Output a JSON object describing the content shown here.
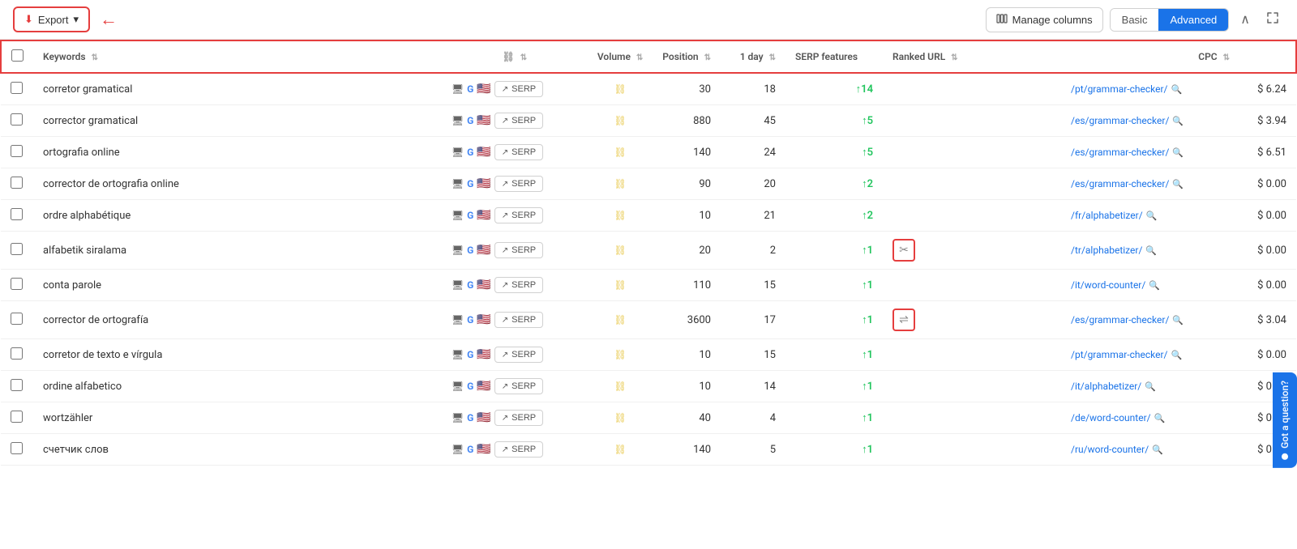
{
  "toolbar": {
    "export_label": "Export",
    "manage_columns_label": "Manage columns",
    "view_basic_label": "Basic",
    "view_advanced_label": "Advanced",
    "active_view": "Advanced"
  },
  "table": {
    "headers": {
      "keyword": "Keywords",
      "link": "",
      "volume": "Volume",
      "position": "Position",
      "oneday": "1 day",
      "serp_features": "SERP features",
      "ranked_url": "Ranked URL",
      "cpc": "CPC"
    },
    "rows": [
      {
        "keyword": "corretor gramatical",
        "volume": "30",
        "position": "18",
        "oneday": "↑14",
        "oneday_val": 14,
        "serp_feature": "",
        "ranked_url": "/pt/grammar-checker/",
        "cpc": "$ 6.24"
      },
      {
        "keyword": "corrector gramatical",
        "volume": "880",
        "position": "45",
        "oneday": "↑5",
        "oneday_val": 5,
        "serp_feature": "",
        "ranked_url": "/es/grammar-checker/",
        "cpc": "$ 3.94"
      },
      {
        "keyword": "ortografia online",
        "volume": "140",
        "position": "24",
        "oneday": "↑5",
        "oneday_val": 5,
        "serp_feature": "",
        "ranked_url": "/es/grammar-checker/",
        "cpc": "$ 6.51"
      },
      {
        "keyword": "corrector de ortografia online",
        "volume": "90",
        "position": "20",
        "oneday": "↑2",
        "oneday_val": 2,
        "serp_feature": "",
        "ranked_url": "/es/grammar-checker/",
        "cpc": "$ 0.00"
      },
      {
        "keyword": "ordre alphabétique",
        "volume": "10",
        "position": "21",
        "oneday": "↑2",
        "oneday_val": 2,
        "serp_feature": "",
        "ranked_url": "/fr/alphabetizer/",
        "cpc": "$ 0.00"
      },
      {
        "keyword": "alfabetik siralama",
        "volume": "20",
        "position": "2",
        "oneday": "↑1",
        "oneday_val": 1,
        "serp_feature": "scissors",
        "ranked_url": "/tr/alphabetizer/",
        "cpc": "$ 0.00"
      },
      {
        "keyword": "conta parole",
        "volume": "110",
        "position": "15",
        "oneday": "↑1",
        "oneday_val": 1,
        "serp_feature": "",
        "ranked_url": "/it/word-counter/",
        "cpc": "$ 0.00"
      },
      {
        "keyword": "corrector de ortografía",
        "volume": "3600",
        "position": "17",
        "oneday": "↑1",
        "oneday_val": 1,
        "serp_feature": "arrows",
        "ranked_url": "/es/grammar-checker/",
        "cpc": "$ 3.04"
      },
      {
        "keyword": "corretor de texto e vírgula",
        "volume": "10",
        "position": "15",
        "oneday": "↑1",
        "oneday_val": 1,
        "serp_feature": "",
        "ranked_url": "/pt/grammar-checker/",
        "cpc": "$ 0.00"
      },
      {
        "keyword": "ordine alfabetico",
        "volume": "10",
        "position": "14",
        "oneday": "↑1",
        "oneday_val": 1,
        "serp_feature": "",
        "ranked_url": "/it/alphabetizer/",
        "cpc": "$ 0.00"
      },
      {
        "keyword": "wortzähler",
        "volume": "40",
        "position": "4",
        "oneday": "↑1",
        "oneday_val": 1,
        "serp_feature": "",
        "ranked_url": "/de/word-counter/",
        "cpc": "$ 0.00"
      },
      {
        "keyword": "счетчик слов",
        "volume": "140",
        "position": "5",
        "oneday": "↑1",
        "oneday_val": 1,
        "serp_feature": "",
        "ranked_url": "/ru/word-counter/",
        "cpc": "$ 0.04"
      }
    ]
  },
  "feedback": {
    "label": "Got a question?"
  },
  "icons": {
    "export": "⬇",
    "dropdown": "▾",
    "manage_columns": "⊞",
    "collapse": "∧",
    "expand": "⤢",
    "serp": "↗",
    "link_chain": "⛓",
    "search": "🔍",
    "monitor": "🖥",
    "g_letter": "G",
    "us_flag": "🇺🇸",
    "scissors": "✂",
    "arrows": "⇌"
  }
}
